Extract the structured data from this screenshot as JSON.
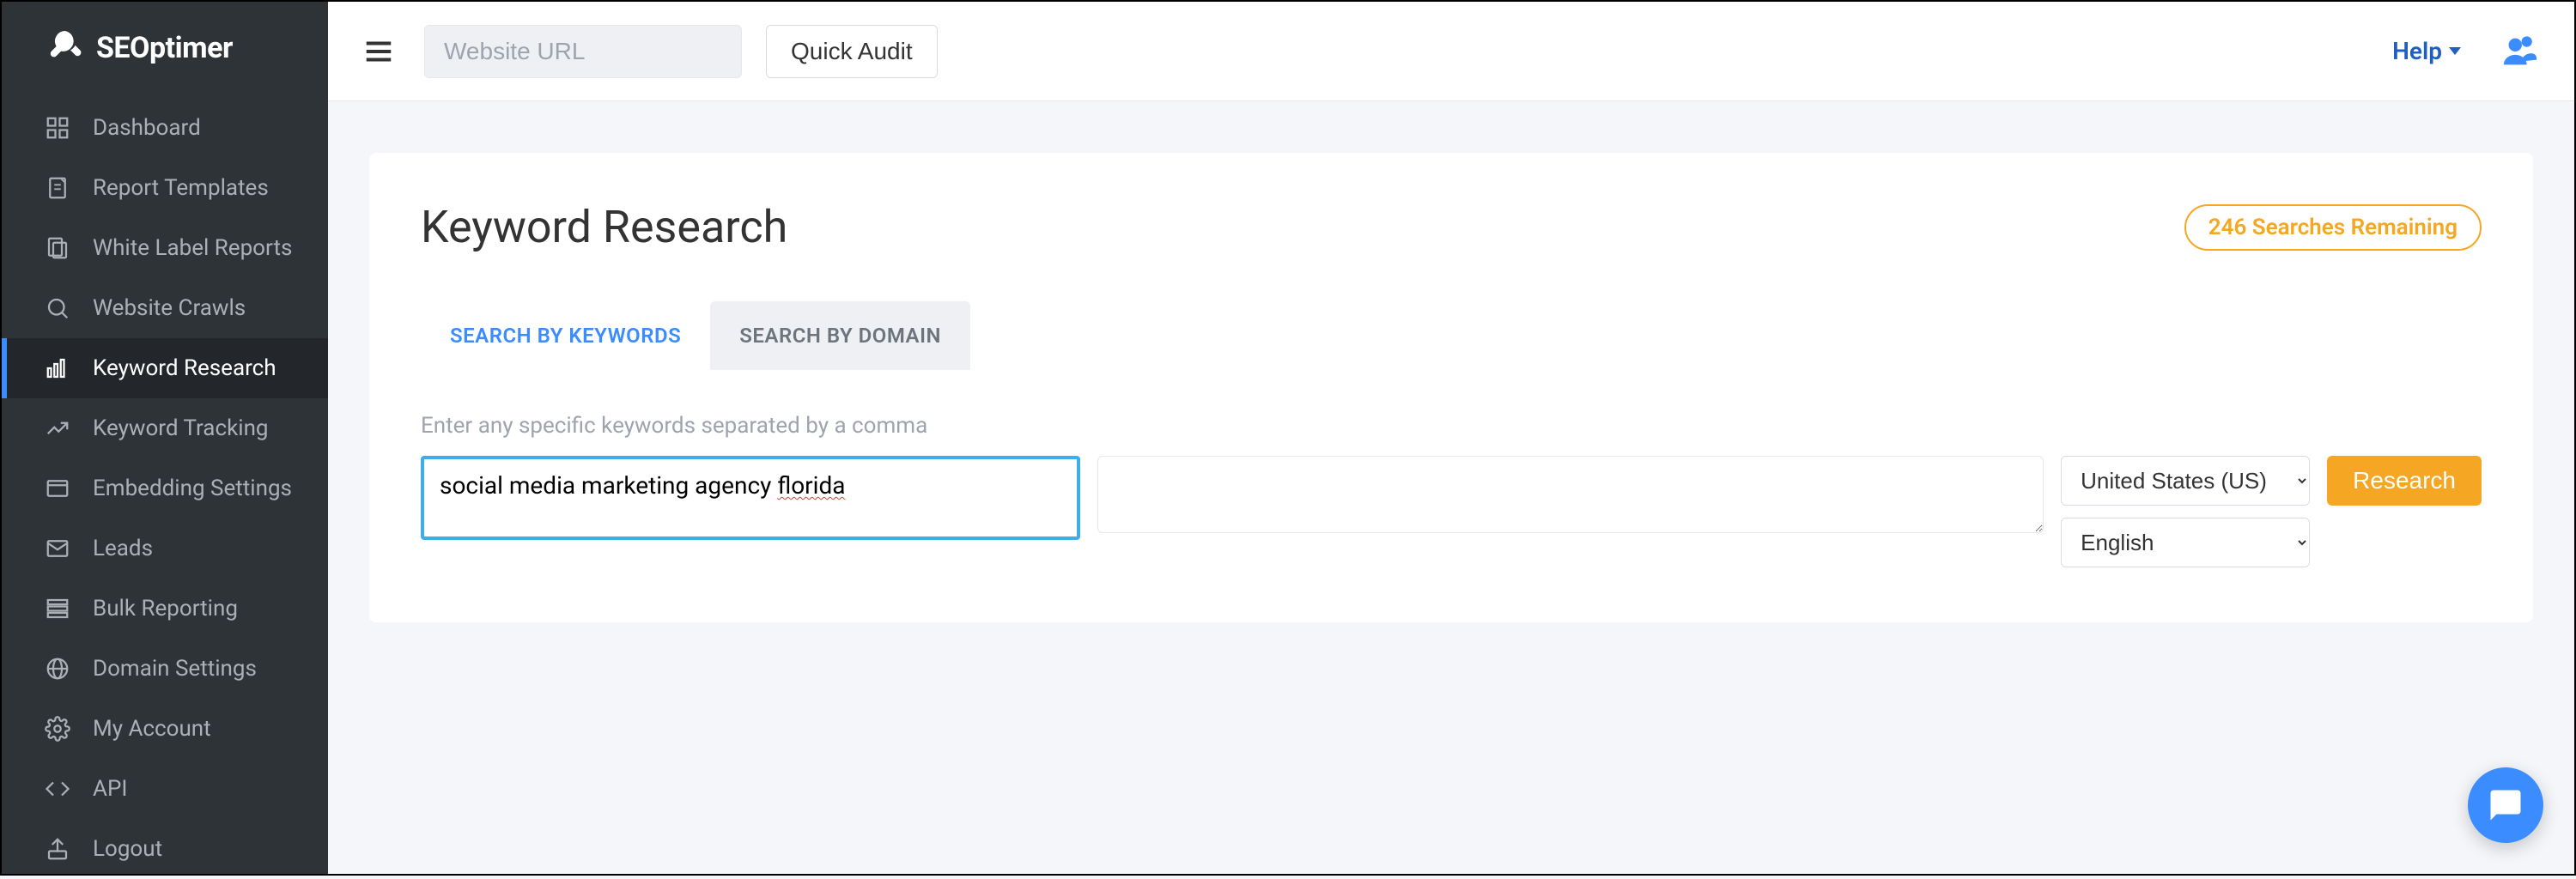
{
  "logo": "SEOptimer",
  "sidebar": {
    "items": [
      {
        "label": "Dashboard",
        "icon": "dashboard"
      },
      {
        "label": "Report Templates",
        "icon": "report"
      },
      {
        "label": "White Label Reports",
        "icon": "whitelabel"
      },
      {
        "label": "Website Crawls",
        "icon": "crawl"
      },
      {
        "label": "Keyword Research",
        "icon": "keyword",
        "active": true
      },
      {
        "label": "Keyword Tracking",
        "icon": "tracking"
      },
      {
        "label": "Embedding Settings",
        "icon": "embed"
      },
      {
        "label": "Leads",
        "icon": "leads"
      },
      {
        "label": "Bulk Reporting",
        "icon": "bulk"
      },
      {
        "label": "Domain Settings",
        "icon": "domain"
      },
      {
        "label": "My Account",
        "icon": "account"
      },
      {
        "label": "API",
        "icon": "api"
      },
      {
        "label": "Logout",
        "icon": "logout"
      }
    ]
  },
  "topbar": {
    "url_placeholder": "Website URL",
    "quick_audit": "Quick Audit",
    "help": "Help"
  },
  "page": {
    "title": "Keyword Research",
    "badge": "246 Searches Remaining",
    "tabs": [
      {
        "label": "SEARCH BY KEYWORDS",
        "active": true
      },
      {
        "label": "SEARCH BY DOMAIN",
        "active": false
      }
    ],
    "hint": "Enter any specific keywords separated by a comma",
    "keyword_value_prefix": "social media marketing agency ",
    "keyword_value_spell": "florida",
    "country": "United States (US)",
    "language": "English",
    "research_btn": "Research"
  }
}
